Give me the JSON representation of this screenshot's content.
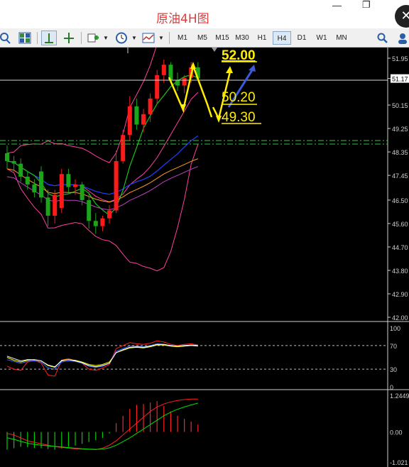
{
  "window": {
    "title": "原油4H图",
    "restore_symbol": "❐",
    "close_symbol": "✕",
    "minimize_symbol": "—"
  },
  "toolbar": {
    "timeframes": [
      "M1",
      "M5",
      "M15",
      "M30",
      "H1",
      "H4",
      "D1",
      "W1",
      "MN"
    ],
    "active_timeframe": "H4"
  },
  "annotations": {
    "target_up": "52.00",
    "level_mid": "50.20",
    "level_low": "49.30"
  },
  "chart_data": [
    {
      "type": "candlestick",
      "title": "",
      "price_labels": [
        "51.95",
        "51.17",
        "50.15",
        "49.25",
        "48.35",
        "47.45",
        "46.50",
        "45.60",
        "44.70",
        "43.80",
        "42.90",
        "42.00"
      ],
      "current_price": "51.17",
      "ylim": [
        42.0,
        51.95
      ],
      "candles": [
        {
          "o": 48.3,
          "h": 48.6,
          "l": 47.7,
          "c": 48.0
        },
        {
          "o": 48.0,
          "h": 48.2,
          "l": 47.6,
          "c": 47.9
        },
        {
          "o": 47.9,
          "h": 48.1,
          "l": 47.2,
          "c": 47.4
        },
        {
          "o": 47.4,
          "h": 47.6,
          "l": 46.9,
          "c": 47.1
        },
        {
          "o": 47.1,
          "h": 47.3,
          "l": 46.6,
          "c": 46.8
        },
        {
          "o": 47.6,
          "h": 47.8,
          "l": 46.4,
          "c": 46.6
        },
        {
          "o": 46.6,
          "h": 46.9,
          "l": 45.5,
          "c": 45.9
        },
        {
          "o": 45.9,
          "h": 46.9,
          "l": 45.6,
          "c": 46.7
        },
        {
          "o": 46.2,
          "h": 47.7,
          "l": 46.0,
          "c": 47.5
        },
        {
          "o": 47.5,
          "h": 47.7,
          "l": 46.8,
          "c": 47.0
        },
        {
          "o": 47.0,
          "h": 47.3,
          "l": 46.7,
          "c": 47.1
        },
        {
          "o": 47.1,
          "h": 47.2,
          "l": 46.3,
          "c": 46.5
        },
        {
          "o": 46.5,
          "h": 46.8,
          "l": 45.4,
          "c": 45.7
        },
        {
          "o": 45.7,
          "h": 46.0,
          "l": 45.2,
          "c": 45.5
        },
        {
          "o": 45.5,
          "h": 45.9,
          "l": 45.3,
          "c": 45.8
        },
        {
          "o": 45.8,
          "h": 46.3,
          "l": 45.6,
          "c": 46.1
        },
        {
          "o": 46.1,
          "h": 48.4,
          "l": 46.0,
          "c": 48.0
        },
        {
          "o": 48.0,
          "h": 49.2,
          "l": 47.9,
          "c": 49.0
        },
        {
          "o": 49.0,
          "h": 50.5,
          "l": 48.8,
          "c": 50.1
        },
        {
          "o": 50.1,
          "h": 50.4,
          "l": 49.2,
          "c": 49.4
        },
        {
          "o": 49.4,
          "h": 50.0,
          "l": 49.1,
          "c": 49.8
        },
        {
          "o": 49.8,
          "h": 50.6,
          "l": 49.5,
          "c": 50.4
        },
        {
          "o": 50.4,
          "h": 51.5,
          "l": 50.2,
          "c": 51.3
        },
        {
          "o": 51.3,
          "h": 51.9,
          "l": 51.0,
          "c": 51.7
        },
        {
          "o": 51.7,
          "h": 51.8,
          "l": 51.0,
          "c": 51.1
        },
        {
          "o": 51.1,
          "h": 51.4,
          "l": 50.7,
          "c": 50.9
        },
        {
          "o": 50.9,
          "h": 51.3,
          "l": 50.6,
          "c": 51.2
        },
        {
          "o": 51.2,
          "h": 51.8,
          "l": 51.0,
          "c": 51.6
        },
        {
          "o": 51.6,
          "h": 51.8,
          "l": 51.1,
          "c": 51.17
        }
      ]
    },
    {
      "type": "line",
      "title": "",
      "y_labels": [
        "100",
        "70",
        "30",
        "0"
      ],
      "levels": [
        70,
        30
      ],
      "ylim": [
        0,
        100
      ],
      "series": [
        {
          "color": "#ff2020",
          "values": [
            35,
            30,
            28,
            42,
            45,
            40,
            20,
            18,
            45,
            48,
            44,
            40,
            30,
            28,
            32,
            38,
            65,
            70,
            75,
            73,
            72,
            74,
            78,
            76,
            72,
            70,
            72,
            73,
            71
          ]
        },
        {
          "color": "#ffff00",
          "values": [
            50,
            45,
            42,
            45,
            46,
            44,
            36,
            33,
            45,
            46,
            45,
            42,
            38,
            36,
            38,
            42,
            58,
            62,
            66,
            67,
            66,
            68,
            71,
            71,
            69,
            68,
            69,
            70,
            69
          ]
        },
        {
          "color": "#3b6bff",
          "values": [
            46,
            43,
            40,
            43,
            44,
            42,
            32,
            30,
            42,
            44,
            43,
            40,
            35,
            33,
            35,
            40,
            60,
            65,
            69,
            69,
            68,
            70,
            73,
            72,
            70,
            69,
            70,
            71,
            70
          ]
        },
        {
          "color": "#ffffff",
          "values": [
            52,
            48,
            44,
            46,
            46,
            44,
            37,
            34,
            44,
            46,
            44,
            41,
            36,
            34,
            36,
            40,
            58,
            63,
            67,
            68,
            67,
            69,
            72,
            72,
            70,
            69,
            70,
            71,
            70
          ]
        }
      ]
    },
    {
      "type": "bar",
      "title": "",
      "y_labels": [
        "1.2449",
        "0.00",
        "-1.021"
      ],
      "ylim": [
        -1.021,
        1.2449
      ],
      "histogram": [
        -0.6,
        -0.55,
        -0.5,
        -0.52,
        -0.54,
        -0.55,
        -0.58,
        -0.6,
        -0.56,
        -0.5,
        -0.46,
        -0.4,
        -0.34,
        -0.28,
        -0.2,
        -0.05,
        0.3,
        0.55,
        0.78,
        0.92,
        0.95,
        1.0,
        1.05,
        0.88,
        0.7,
        0.55,
        0.45,
        0.35,
        0.25
      ],
      "series": [
        {
          "color": "#ff2020",
          "values": [
            -0.05,
            -0.1,
            -0.2,
            -0.3,
            -0.35,
            -0.4,
            -0.45,
            -0.5,
            -0.52,
            -0.55,
            -0.57,
            -0.58,
            -0.59,
            -0.6,
            -0.55,
            -0.45,
            -0.3,
            -0.1,
            0.1,
            0.3,
            0.5,
            0.7,
            0.85,
            0.95,
            1.02,
            1.07,
            1.1,
            1.12,
            1.12
          ]
        },
        {
          "color": "#00e000",
          "values": [
            -0.2,
            -0.25,
            -0.32,
            -0.38,
            -0.42,
            -0.45,
            -0.47,
            -0.49,
            -0.51,
            -0.53,
            -0.55,
            -0.57,
            -0.58,
            -0.59,
            -0.58,
            -0.54,
            -0.45,
            -0.33,
            -0.2,
            -0.05,
            0.1,
            0.25,
            0.4,
            0.55,
            0.67,
            0.77,
            0.85,
            0.92,
            0.98
          ]
        }
      ]
    }
  ],
  "overlays": {
    "hline_color": "#d8d8d8",
    "dash_color": "#2ecc40",
    "arrow_yellow": "#ffee00",
    "arrow_blue": "#3b5bdb"
  }
}
